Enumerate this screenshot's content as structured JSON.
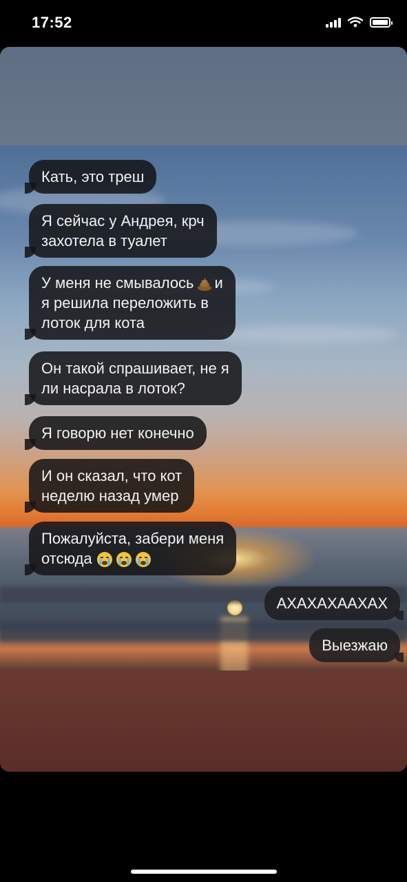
{
  "status_bar": {
    "time": "17:52",
    "icons": [
      "signal-icon",
      "wifi-icon",
      "battery-icon"
    ]
  },
  "chat": {
    "incoming": [
      "Кать, это треш",
      "Я сейчас у Андрея, крч\nзахотела в туалет",
      {
        "before": "У меня не смывалось",
        "emoji": "poop-emoji",
        "after": "и\nя решила переложить в\nлоток для кота"
      },
      "Он такой спрашивает, не я\nли насрала в лоток?",
      "Я говорю нет конечно",
      "И он сказал, что кот\nнеделю назад умер",
      {
        "text": "Пожалуйста, забери меня\nотсюда",
        "emoji": "crying-face-emoji",
        "emoji_count": 3
      }
    ],
    "outgoing": [
      "АХАХАХААХАХ",
      "Выезжаю"
    ]
  },
  "colors": {
    "bubble": "#141416",
    "text": "#f2f2f2",
    "background": "#000000"
  }
}
